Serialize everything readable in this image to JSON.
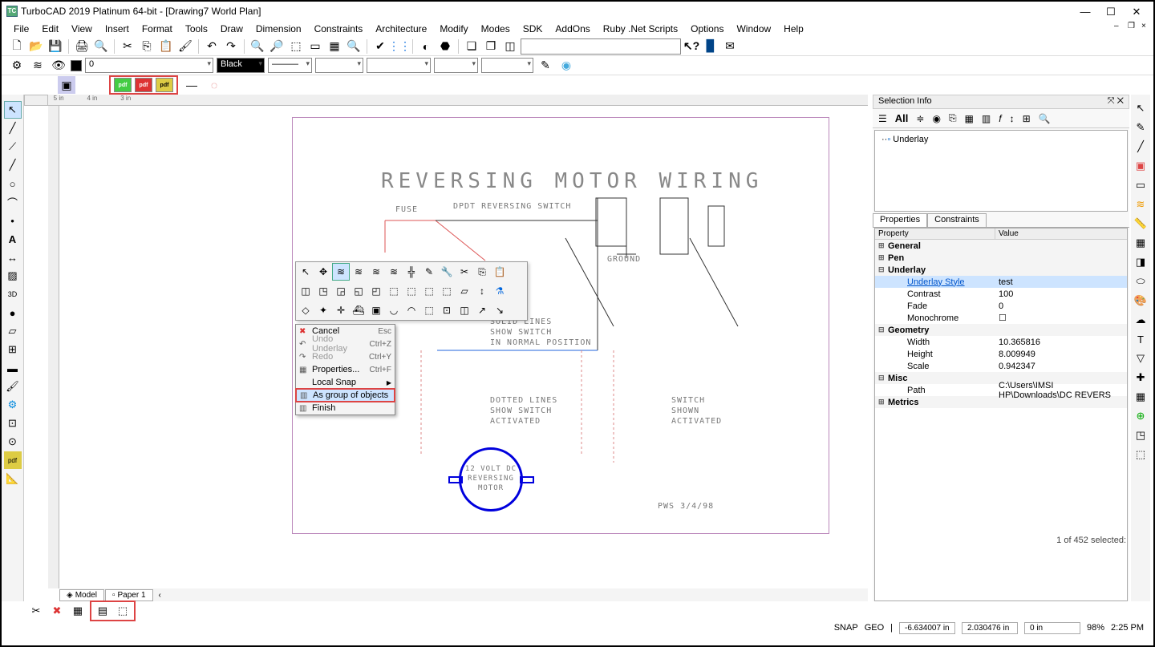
{
  "title": "TurboCAD 2019 Platinum 64-bit - [Drawing7 World Plan]",
  "menus": [
    "File",
    "Edit",
    "View",
    "Insert",
    "Format",
    "Tools",
    "Draw",
    "Dimension",
    "Constraints",
    "Architecture",
    "Modify",
    "Modes",
    "SDK",
    "AddOns",
    "Ruby .Net Scripts",
    "Options",
    "Window",
    "Help"
  ],
  "layer_value": "0",
  "color_value": "Black",
  "context_menu": [
    {
      "label": "Cancel",
      "sc": "Esc",
      "icon": "✖",
      "color": "#d33"
    },
    {
      "label": "Undo Underlay",
      "sc": "Ctrl+Z",
      "icon": "↶",
      "disabled": true
    },
    {
      "label": "Redo",
      "sc": "Ctrl+Y",
      "icon": "↷",
      "disabled": true
    },
    {
      "label": "Properties...",
      "sc": "Ctrl+F",
      "icon": "▦"
    },
    {
      "label": "Local Snap",
      "arrow": true
    },
    {
      "label": "As group of objects",
      "icon": "▥",
      "hl": true
    },
    {
      "label": "Finish",
      "icon": "▥"
    }
  ],
  "panel_title": "Selection Info",
  "filter_all": "All",
  "tree_item": "Underlay",
  "tabs": {
    "props": "Properties",
    "constr": "Constraints"
  },
  "prop_head": {
    "c1": "Property",
    "c2": "Value"
  },
  "props": [
    {
      "cat": true,
      "exp": "⊞",
      "name": "General"
    },
    {
      "cat": true,
      "exp": "⊞",
      "name": "Pen"
    },
    {
      "cat": true,
      "exp": "⊟",
      "name": "Underlay"
    },
    {
      "indent": true,
      "link": true,
      "sel": true,
      "name": "Underlay Style",
      "value": "test"
    },
    {
      "indent": true,
      "name": "Contrast",
      "value": "100"
    },
    {
      "indent": true,
      "name": "Fade",
      "value": "0"
    },
    {
      "indent": true,
      "name": "Monochrome",
      "value": "☐"
    },
    {
      "cat": true,
      "exp": "⊟",
      "name": "Geometry"
    },
    {
      "indent": true,
      "name": "Width",
      "value": "10.365816"
    },
    {
      "indent": true,
      "name": "Height",
      "value": "8.009949"
    },
    {
      "indent": true,
      "name": "Scale",
      "value": "0.942347"
    },
    {
      "cat": true,
      "exp": "⊟",
      "name": "Misc"
    },
    {
      "indent": true,
      "name": "Path",
      "value": "C:\\Users\\IMSI HP\\Downloads\\DC REVERS"
    },
    {
      "cat": true,
      "exp": "⊞",
      "name": "Metrics"
    }
  ],
  "sel_count": "1 of 452 selected:",
  "drawing": {
    "title": "REVERSING MOTOR WIRING",
    "fuse": "FUSE",
    "switch": "DPDT REVERSING SWITCH",
    "ground": "GROUND",
    "solid": "SOLID LINES\nSHOW SWITCH\nIN NORMAL POSITION",
    "dotted": "DOTTED LINES\nSHOW SWITCH\nACTIVATED",
    "act": "SWITCH\nSHOWN\nACTIVATED",
    "motor": "12 VOLT DC\nREVERSING\nMOTOR",
    "sig": "PWS  3/4/98"
  },
  "canvas_tabs": {
    "model": "Model",
    "paper": "Paper 1"
  },
  "status": {
    "snap": "SNAP",
    "geo": "GEO",
    "x": "-6.634007 in",
    "y": "2.030476 in",
    "z": "0 in",
    "zoom": "98%",
    "time": "2:25 PM"
  }
}
